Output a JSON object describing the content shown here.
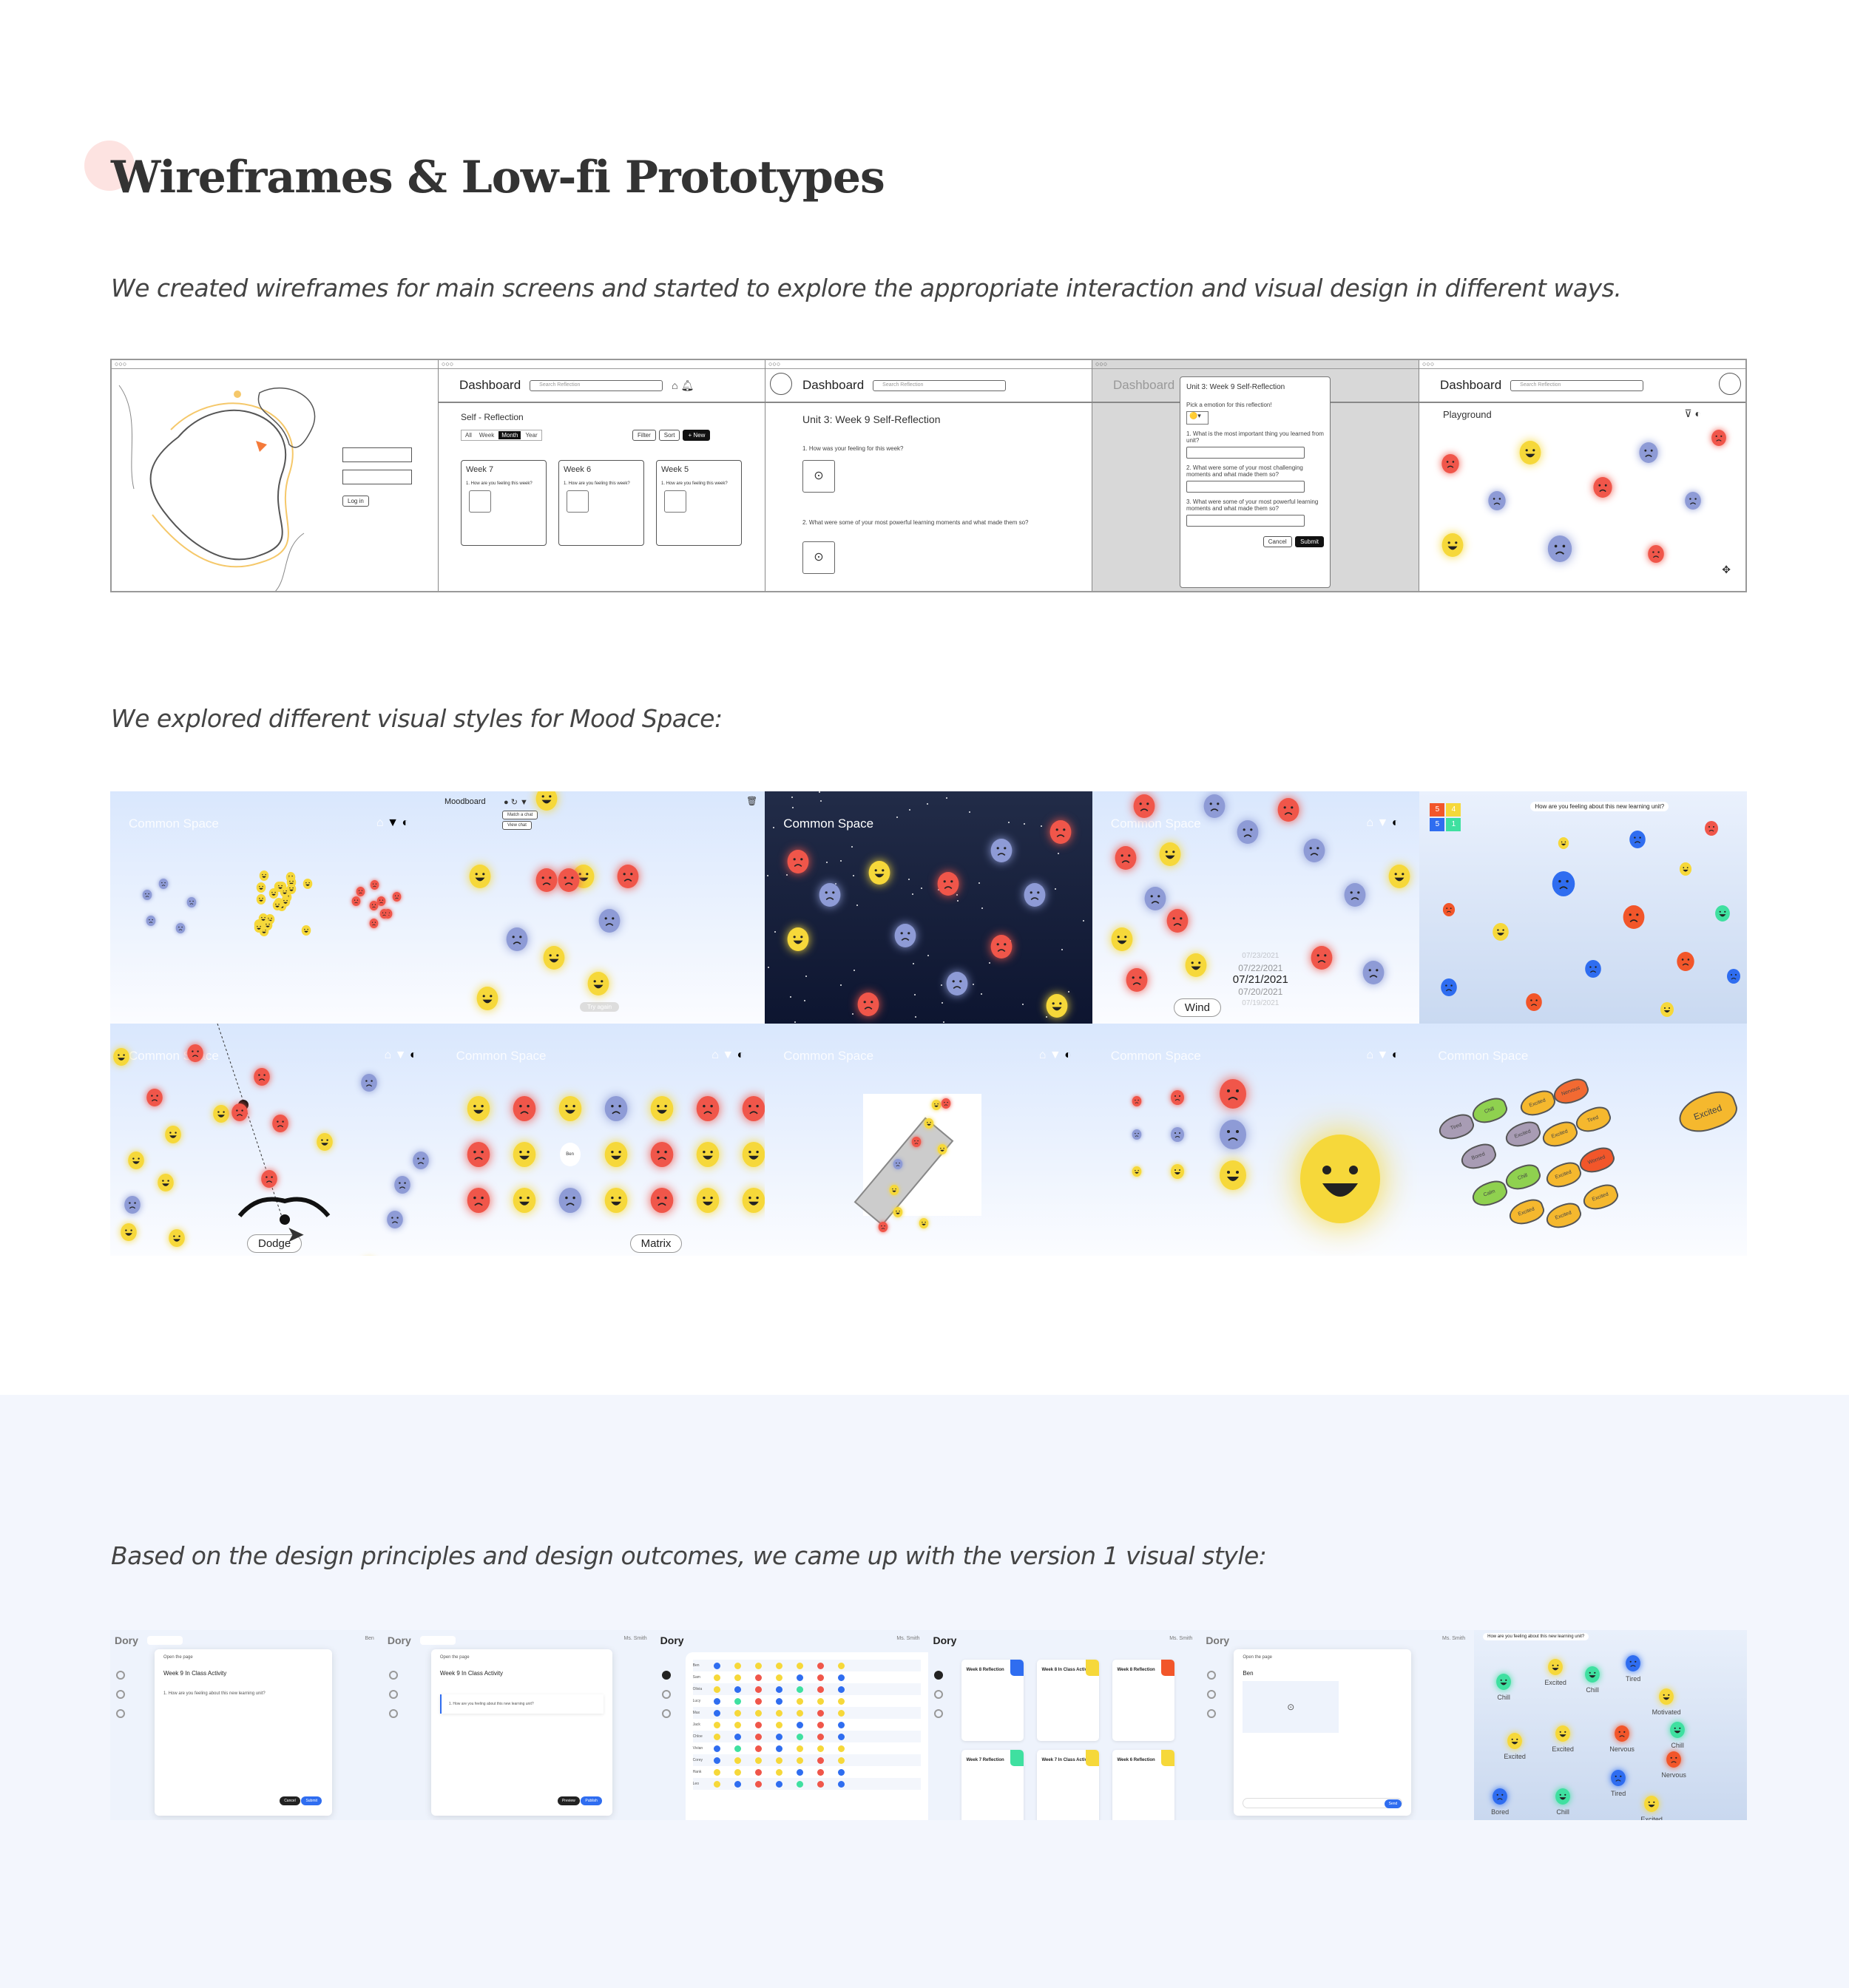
{
  "header": {
    "title": "Wireframes & Low-fi Prototypes",
    "intro": "We created wireframes for main screens and started to explore the appropriate interaction and visual design in different ways."
  },
  "colors": {
    "accent_dot": "#fde3e1",
    "yellow": "#f6d83a",
    "red": "#f0564a",
    "purple": "#8e9bd6",
    "blue": "#2f6df0",
    "orange": "#f2562a",
    "green": "#3fe0a0",
    "dark_space": "#18213d",
    "bottom_bg": "#f3f6fd"
  },
  "wireframes": {
    "login": {
      "login_button": "Log in"
    },
    "dashboard": {
      "title": "Dashboard",
      "search_placeholder": "Search Reflection",
      "section": "Self - Reflection",
      "tabs": [
        "All",
        "Week",
        "Month",
        "Year"
      ],
      "filter": "Filter",
      "sort": "Sort",
      "new": "+ New",
      "cards": [
        {
          "title": "Week 7",
          "q": "1. How are you feeling this week?"
        },
        {
          "title": "Week 6",
          "q": "1. How are you feeling this week?"
        },
        {
          "title": "Week 5",
          "q": "1. How are you feeling this week?"
        }
      ]
    },
    "reflection": {
      "title": "Unit 3: Week 9 Self-Reflection",
      "q1": "1. How was your feeling for this week?",
      "q2": "2. What were some of your most powerful learning moments and what made them so?"
    },
    "modal": {
      "title": "Unit 3: Week 9 Self-Reflection",
      "pick": "Pick a emotion for this reflection!",
      "q1": "1. What is the most important thing you learned from unit?",
      "q2": "2. What were some of your most challenging moments and what made them so?",
      "q3": "3. What were some of your most powerful learning moments and what made them so?",
      "cancel": "Cancel",
      "submit": "Submit"
    },
    "playground": {
      "title": "Playground"
    }
  },
  "mood_intro": "We explored different visual styles for Mood Space:",
  "mood": {
    "common_space": "Common Space",
    "moodboard": "Moodboard",
    "match_chat": "Match a chat",
    "view_chat": "View chat",
    "try_again": "Try again",
    "wind": "Wind",
    "dates": [
      "07/23/2021",
      "07/22/2021",
      "07/21/2021",
      "07/20/2021",
      "07/19/2021"
    ],
    "question": "How are you feeling about this new learning unit?",
    "scores": [
      "5",
      "4",
      "5",
      "1"
    ],
    "dodge": "Dodge",
    "matrix": "Matrix",
    "ben": "Ben",
    "fish": [
      "Tired",
      "Chill",
      "Excited",
      "Nervous",
      "Bored",
      "Excited",
      "Excited",
      "Tired",
      "Worried",
      "Chill",
      "Excited",
      "Calm",
      "Excited",
      "Excited",
      "Excited",
      "Excited"
    ]
  },
  "v1_intro": "Based on the design principles and design outcomes, we came up with the version 1 visual style:",
  "v1": {
    "brand": "Dory",
    "user_ben": "Ben",
    "user_teacher": "Ms. Smith",
    "open_page": "Open the page",
    "activity": "Week 9 In Class Activity",
    "question": "1. How are you feeling about this new learning unit?",
    "cancel": "Cancel",
    "submit": "Submit",
    "preview": "Preview",
    "publish": "Publish",
    "students": [
      "Ben",
      "Sam",
      "Olivia",
      "Lucy",
      "Max",
      "Jack",
      "Chloe",
      "Vivian",
      "Corey",
      "Hank",
      "Leo"
    ],
    "reflection_cards": [
      "Week 8 Reflection",
      "Week 8 In Class Activity",
      "Week 8 Reflection",
      "Week 7 Reflection",
      "Week 7 In Class Activity",
      "Week 6 Reflection"
    ],
    "student_name": "Ben",
    "send": "Send",
    "emotion_labels": [
      "Chill",
      "Excited",
      "Chill",
      "Tired",
      "Motivated",
      "Excited",
      "Excited",
      "Nervous",
      "Chill",
      "Nervous",
      "Tired",
      "Bored",
      "Chill",
      "Excited"
    ]
  }
}
